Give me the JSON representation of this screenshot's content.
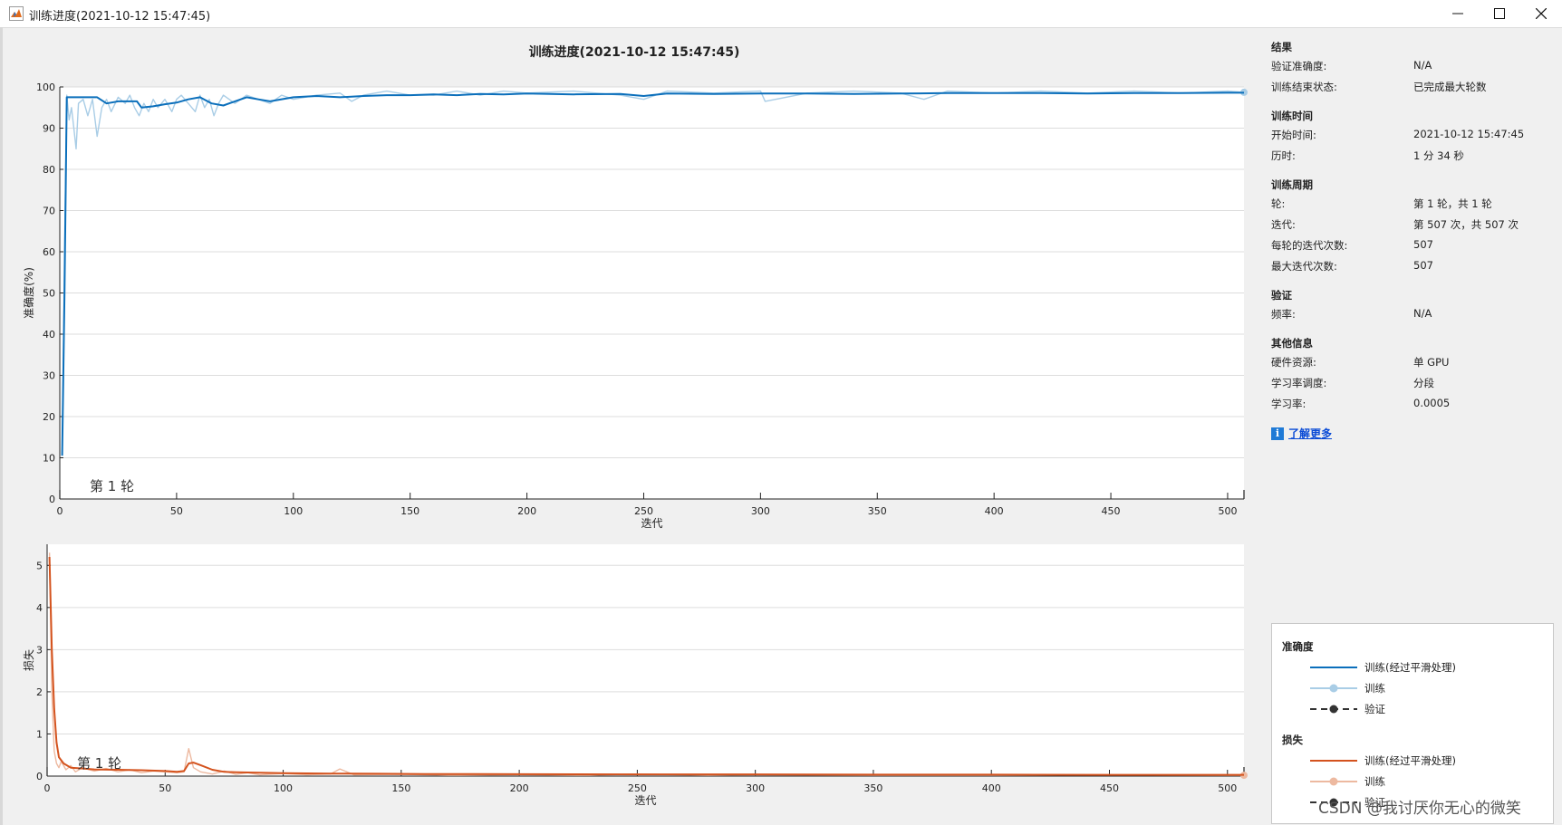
{
  "window": {
    "title": "训练进度(2021-10-12 15:47:45)",
    "minimize_icon": "minimize-icon",
    "maximize_icon": "maximize-icon",
    "close_icon": "close-icon"
  },
  "figure": {
    "title": "训练进度(2021-10-12 15:47:45)"
  },
  "colors": {
    "accuracy_smoothed": "#0b6fbb",
    "accuracy_raw": "#a9cde6",
    "loss_smoothed": "#d4531e",
    "loss_raw": "#edb9a0",
    "validation": "#333333",
    "grid": "#dddddd"
  },
  "chart_data": [
    {
      "type": "line",
      "name": "accuracy",
      "ylabel": "准确度(%)",
      "xlabel": "迭代",
      "xlim": [
        0,
        507
      ],
      "ylim": [
        0,
        100
      ],
      "xticks": [
        0,
        50,
        100,
        150,
        200,
        250,
        300,
        350,
        400,
        450,
        500
      ],
      "yticks": [
        0,
        10,
        20,
        30,
        40,
        50,
        60,
        70,
        80,
        90,
        100
      ],
      "grid": true,
      "epoch_label": "第 1 轮",
      "epoch_marks": [
        0,
        507
      ],
      "series": [
        {
          "name": "训练(经过平滑处理)",
          "x": [
            1,
            2,
            3,
            5,
            10,
            15,
            16,
            20,
            25,
            30,
            33,
            35,
            40,
            45,
            50,
            55,
            60,
            65,
            70,
            75,
            80,
            85,
            90,
            100,
            110,
            120,
            130,
            140,
            150,
            160,
            170,
            180,
            190,
            200,
            220,
            240,
            250,
            260,
            280,
            300,
            320,
            340,
            360,
            380,
            400,
            420,
            440,
            460,
            480,
            500,
            507
          ],
          "y": [
            10.5,
            50,
            97.5,
            97.5,
            97.5,
            97.5,
            97.5,
            96,
            96.5,
            96.5,
            96.5,
            95,
            95.3,
            95.8,
            96.2,
            97,
            97.5,
            96,
            95.5,
            96.5,
            97.5,
            97,
            96.5,
            97.5,
            97.8,
            97.5,
            97.8,
            98,
            98,
            98.2,
            98,
            98.3,
            98.2,
            98.4,
            98.2,
            98.3,
            97.8,
            98.4,
            98.3,
            98.4,
            98.4,
            98.3,
            98.4,
            98.5,
            98.5,
            98.5,
            98.4,
            98.5,
            98.5,
            98.6,
            98.6
          ]
        },
        {
          "name": "训练",
          "x": [
            1,
            2,
            3,
            4,
            5,
            6,
            7,
            8,
            10,
            12,
            14,
            16,
            18,
            20,
            22,
            25,
            28,
            30,
            32,
            34,
            36,
            38,
            40,
            42,
            45,
            48,
            50,
            52,
            55,
            58,
            60,
            62,
            64,
            66,
            68,
            70,
            75,
            80,
            85,
            90,
            95,
            100,
            110,
            120,
            125,
            130,
            140,
            150,
            160,
            170,
            180,
            190,
            200,
            220,
            240,
            250,
            260,
            280,
            300,
            302,
            320,
            340,
            360,
            370,
            380,
            400,
            420,
            440,
            460,
            480,
            500,
            507
          ],
          "y": [
            10.5,
            60,
            98,
            92,
            95,
            90,
            85,
            96,
            97,
            93,
            97,
            88,
            95,
            97,
            94,
            97.5,
            96,
            98,
            95,
            93,
            96,
            94,
            97,
            95,
            97,
            94,
            97,
            98,
            96,
            94,
            98,
            95,
            97,
            93,
            96,
            98,
            96,
            98,
            97,
            96,
            98,
            97,
            98,
            98.5,
            96.5,
            98,
            99,
            98,
            98,
            99,
            98,
            99,
            98.5,
            99,
            98,
            97,
            99,
            98.5,
            99,
            96.5,
            98.5,
            99,
            98.5,
            97,
            99,
            98.5,
            99,
            98.5,
            99,
            98.5,
            99,
            98.7
          ]
        },
        {
          "name": "验证",
          "x": [],
          "y": []
        }
      ]
    },
    {
      "type": "line",
      "name": "loss",
      "ylabel": "损失",
      "xlabel": "迭代",
      "xlim": [
        0,
        507
      ],
      "ylim": [
        0,
        5.5
      ],
      "xticks": [
        0,
        50,
        100,
        150,
        200,
        250,
        300,
        350,
        400,
        450,
        500
      ],
      "yticks": [
        0,
        1,
        2,
        3,
        4,
        5
      ],
      "grid": true,
      "epoch_label": "第 1 轮",
      "epoch_marks": [
        0,
        507
      ],
      "series": [
        {
          "name": "训练(经过平滑处理)",
          "x": [
            1,
            2,
            3,
            4,
            5,
            7,
            10,
            15,
            20,
            30,
            40,
            50,
            55,
            58,
            60,
            62,
            65,
            70,
            75,
            80,
            90,
            100,
            120,
            140,
            160,
            180,
            200,
            250,
            300,
            350,
            400,
            450,
            500,
            507
          ],
          "y": [
            5.2,
            3.0,
            1.6,
            0.8,
            0.45,
            0.3,
            0.2,
            0.18,
            0.16,
            0.15,
            0.14,
            0.12,
            0.1,
            0.12,
            0.3,
            0.32,
            0.26,
            0.15,
            0.1,
            0.09,
            0.08,
            0.07,
            0.06,
            0.055,
            0.05,
            0.05,
            0.045,
            0.04,
            0.04,
            0.035,
            0.035,
            0.03,
            0.03,
            0.03
          ]
        },
        {
          "name": "训练",
          "x": [
            1,
            2,
            3,
            4,
            5,
            6,
            8,
            10,
            12,
            15,
            20,
            25,
            30,
            35,
            40,
            45,
            50,
            55,
            58,
            60,
            62,
            65,
            70,
            75,
            80,
            85,
            90,
            100,
            110,
            120,
            124,
            130,
            150,
            170,
            200,
            230,
            250,
            280,
            300,
            350,
            400,
            450,
            500,
            507
          ],
          "y": [
            5.3,
            2.0,
            0.6,
            0.3,
            0.2,
            0.35,
            0.15,
            0.25,
            0.1,
            0.2,
            0.12,
            0.18,
            0.1,
            0.15,
            0.08,
            0.12,
            0.1,
            0.08,
            0.1,
            0.65,
            0.2,
            0.1,
            0.05,
            0.12,
            0.04,
            0.08,
            0.03,
            0.06,
            0.03,
            0.05,
            0.17,
            0.03,
            0.04,
            0.02,
            0.03,
            0.02,
            0.05,
            0.02,
            0.03,
            0.02,
            0.02,
            0.03,
            0.02,
            0.02
          ]
        },
        {
          "name": "验证",
          "x": [],
          "y": []
        }
      ]
    }
  ],
  "info": {
    "results": {
      "heading": "结果",
      "val_acc_label": "验证准确度:",
      "val_acc": "N/A",
      "end_state_label": "训练结束状态:",
      "end_state": "已完成最大轮数"
    },
    "time": {
      "heading": "训练时间",
      "start_label": "开始时间:",
      "start": "2021-10-12 15:47:45",
      "elapsed_label": "历时:",
      "elapsed": "1 分 34 秒"
    },
    "cycle": {
      "heading": "训练周期",
      "epoch_label": "轮:",
      "epoch": "第 1 轮，共 1 轮",
      "iter_label": "迭代:",
      "iter": "第 507 次，共 507 次",
      "iter_per_epoch_label": "每轮的迭代次数:",
      "iter_per_epoch": "507",
      "max_iter_label": "最大迭代次数:",
      "max_iter": "507"
    },
    "validation": {
      "heading": "验证",
      "freq_label": "频率:",
      "freq": "N/A"
    },
    "other": {
      "heading": "其他信息",
      "hw_label": "硬件资源:",
      "hw": "单 GPU",
      "lr_sched_label": "学习率调度:",
      "lr_sched": "分段",
      "lr_label": "学习率:",
      "lr": "0.0005"
    },
    "learn_more": "了解更多"
  },
  "legend": {
    "accuracy_heading": "准确度",
    "loss_heading": "损失",
    "smoothed": "训练(经过平滑处理)",
    "train": "训练",
    "validation": "验证"
  },
  "watermark": "CSDN @我讨厌你无心的微笑"
}
